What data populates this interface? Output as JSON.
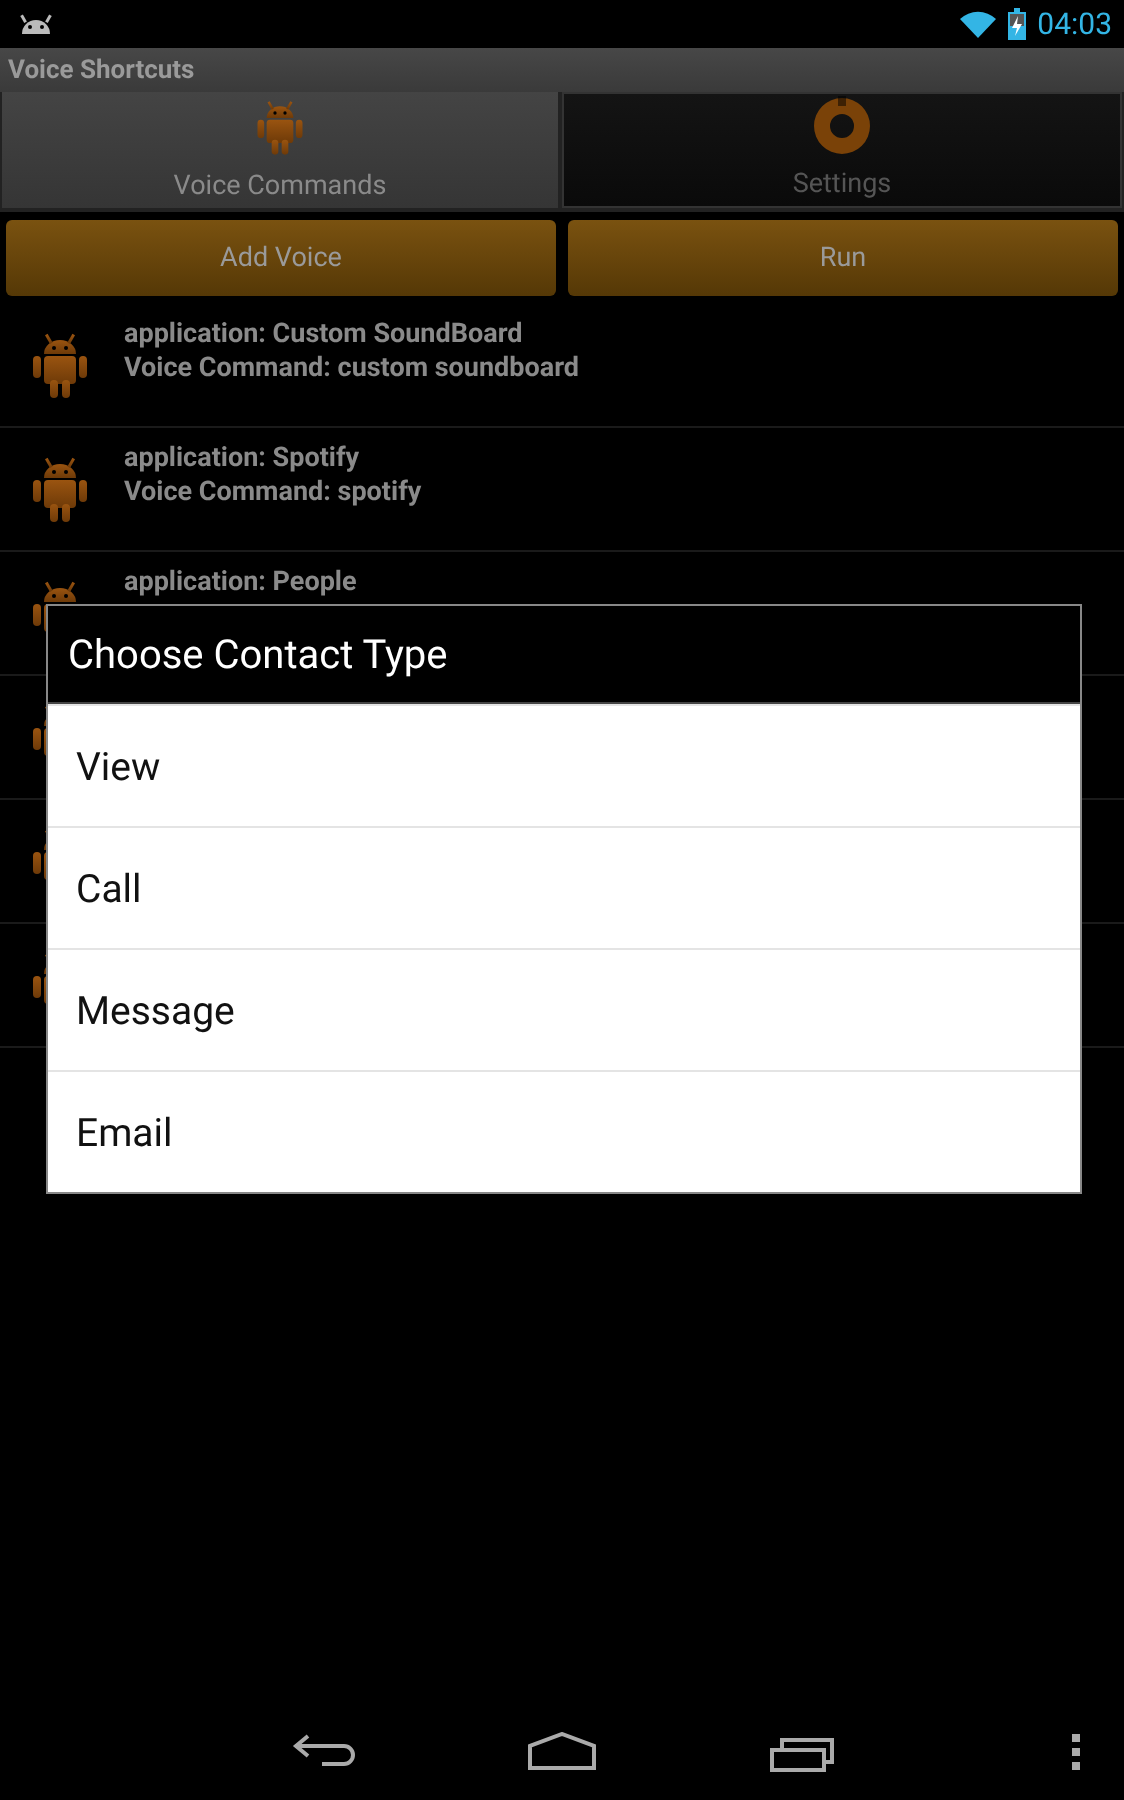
{
  "status_bar": {
    "time": "04:03"
  },
  "app_bar": {
    "title": "Voice Shortcuts"
  },
  "tabs": [
    {
      "label": "Voice Commands",
      "selected": true
    },
    {
      "label": "Settings",
      "selected": false
    }
  ],
  "buttons": [
    "Add Voice",
    "Run"
  ],
  "entries": [
    {
      "kind": "entry",
      "application": "application: Custom SoundBoard",
      "command": "Voice Command: custom soundboard"
    },
    {
      "kind": "entry",
      "application": "application: Spotify",
      "command": "Voice Command: spotify"
    },
    {
      "kind": "entry",
      "application": "application: People"
    },
    {
      "kind": "covered"
    },
    {
      "kind": "covered"
    },
    {
      "kind": "covered"
    }
  ],
  "dialog": {
    "title": "Choose Contact Type",
    "options": [
      "View",
      "Call",
      "Message",
      "Email"
    ]
  }
}
